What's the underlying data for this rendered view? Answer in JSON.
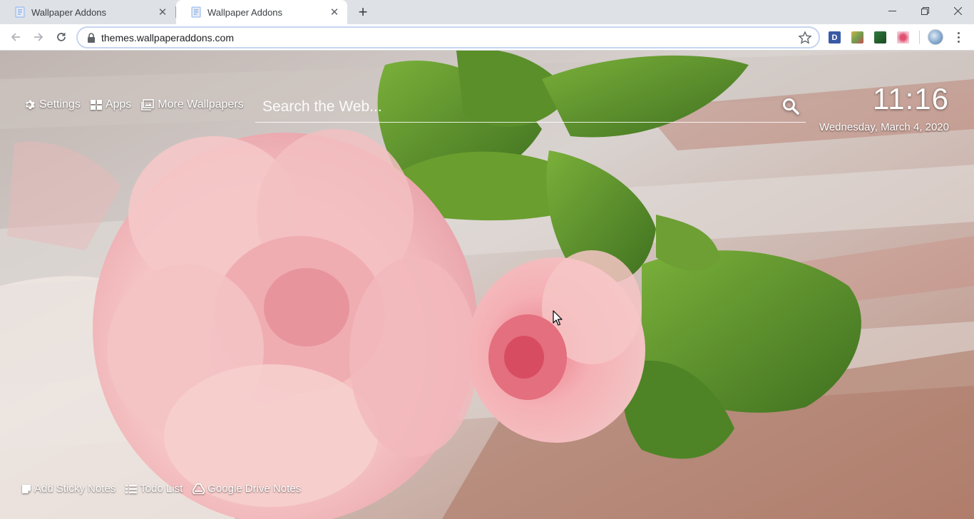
{
  "browser": {
    "tabs": [
      {
        "title": "Wallpaper Addons",
        "active": false
      },
      {
        "title": "Wallpaper Addons",
        "active": true
      }
    ],
    "address_bar": {
      "url": "themes.wallpaperaddons.com"
    },
    "extensions": [
      {
        "name": "d-extension-icon",
        "label": "D"
      },
      {
        "name": "extension-2-icon"
      },
      {
        "name": "extension-3-icon"
      },
      {
        "name": "extension-4-icon"
      }
    ]
  },
  "page": {
    "top_links": {
      "settings": "Settings",
      "apps": "Apps",
      "more_wallpapers": "More Wallpapers"
    },
    "search": {
      "placeholder": "Search the Web..."
    },
    "clock": {
      "time": "11:16",
      "date": "Wednesday, March 4, 2020"
    },
    "bottom_links": {
      "sticky_notes": "Add Sticky Notes",
      "todo_list": "Todo List",
      "google_drive_notes": "Google Drive Notes"
    },
    "wallpaper_subject": "pink roses on weathered wooden table"
  },
  "colors": {
    "chrome_bg": "#dee1e6",
    "page_text": "#ffffff",
    "rose_pink": "#f2b5b8",
    "leaf_green": "#5a8f2a"
  }
}
